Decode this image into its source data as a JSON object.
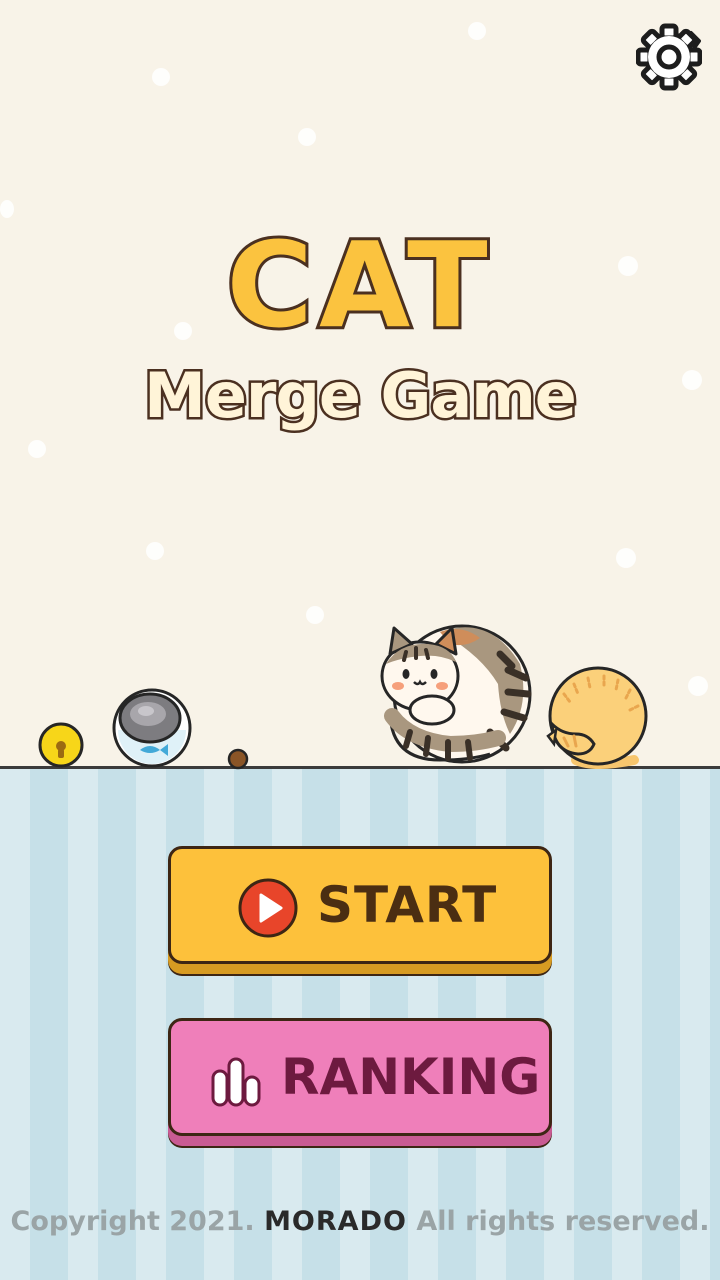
{
  "title": {
    "main": "CAT",
    "sub": "Merge Game"
  },
  "buttons": {
    "start_label": "START",
    "ranking_label": "RANKING"
  },
  "footer": {
    "prefix": "Copyright 2021.",
    "brand": "MORADO",
    "suffix": "All rights reserved."
  },
  "icons": {
    "settings": "gear-icon",
    "start": "play-icon",
    "ranking": "bar-chart-icon"
  },
  "colors": {
    "background": "#f8f3e8",
    "start_button": "#fdc13b",
    "ranking_button": "#ef7fba",
    "title_fill": "#fbc33f",
    "outline": "#4b3020"
  }
}
